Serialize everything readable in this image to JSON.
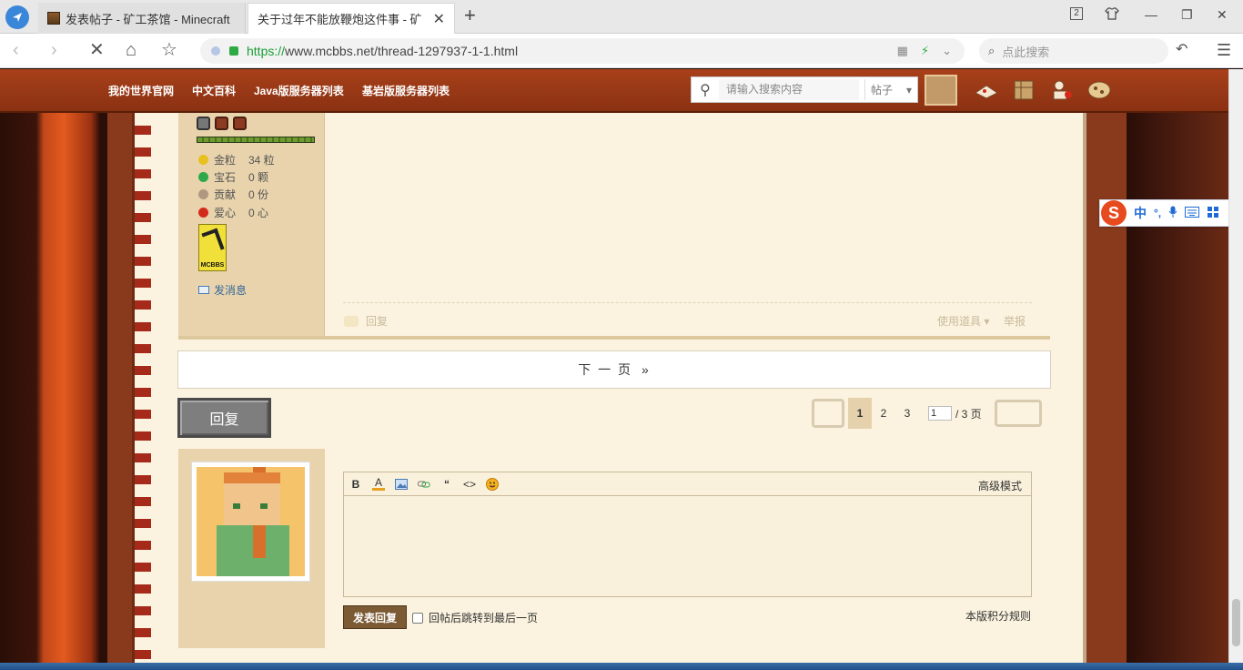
{
  "browser": {
    "tabs": [
      {
        "title": "发表帖子 - 矿工茶馆 - Minecraft",
        "active": false
      },
      {
        "title": "关于过年不能放鞭炮这件事 - 矿",
        "active": true
      }
    ],
    "window_badge": "2",
    "url": {
      "scheme": "https://",
      "rest": "www.mcbbs.net/thread-1297937-1-1.html"
    },
    "search_placeholder": "点此搜索"
  },
  "site_nav": {
    "links": [
      "我的世界官网",
      "中文百科",
      "Java版服务器列表",
      "基岩版服务器列表"
    ],
    "search_placeholder": "请输入搜索内容",
    "search_type": "帖子"
  },
  "user_stats": [
    {
      "label": "金粒",
      "value": "34 粒",
      "color": "#e8c020"
    },
    {
      "label": "宝石",
      "value": "0 颗",
      "color": "#2ea84a"
    },
    {
      "label": "贡献",
      "value": "0 份",
      "color": "#b09880"
    },
    {
      "label": "爱心",
      "value": "0 心",
      "color": "#d42a1a"
    }
  ],
  "medal_text": "MCBBS",
  "send_message": "发消息",
  "post_actions": {
    "reply": "回复",
    "tools": "使用道具 ▾",
    "report": "举报"
  },
  "next_page": {
    "label": "下 一 页",
    "arrow": "»"
  },
  "reply_button": "回复",
  "pager": {
    "pages": [
      "1",
      "2",
      "3"
    ],
    "current": "1",
    "jump_value": "1",
    "total": "/ 3 页"
  },
  "editor": {
    "advanced": "高级模式",
    "tools": [
      "B",
      "A",
      "img",
      "link",
      "“",
      "<>",
      "smile"
    ]
  },
  "submit": "发表回复",
  "jump_last": "回帖后跳转到最后一页",
  "rules": "本版积分规则",
  "ime": {
    "lang": "中",
    "punct": "°,",
    "mic": "mic",
    "kbd": "kbd",
    "menu": "menu"
  }
}
